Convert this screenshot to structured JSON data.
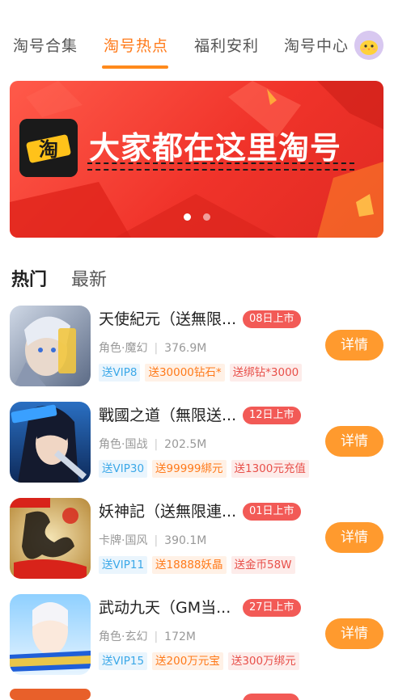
{
  "top_tabs": [
    {
      "label": "淘号合集",
      "active": false
    },
    {
      "label": "淘号热点",
      "active": true
    },
    {
      "label": "福利安利",
      "active": false
    },
    {
      "label": "淘号中心",
      "active": false
    }
  ],
  "banner": {
    "text": "大家都在这里淘号",
    "logo_glyph": "淘",
    "dots": 2,
    "active_dot": 0
  },
  "section_tabs": [
    {
      "label": "热门",
      "active": true
    },
    {
      "label": "最新",
      "active": false
    }
  ],
  "games": [
    {
      "title": "天使紀元（送無限...",
      "date": "08日上市",
      "category": "角色·魔幻",
      "size": "376.9M",
      "tags": [
        {
          "text": "送VIP8",
          "color": "blue"
        },
        {
          "text": "送30000钻石*",
          "color": "orange"
        },
        {
          "text": "送绑钻*3000",
          "color": "red"
        }
      ],
      "button": "详情",
      "icon": "angel-knight-icon"
    },
    {
      "title": "戰國之道（無限送...",
      "date": "12日上市",
      "category": "角色·国战",
      "size": "202.5M",
      "tags": [
        {
          "text": "送VIP30",
          "color": "blue"
        },
        {
          "text": "送99999綁元",
          "color": "orange"
        },
        {
          "text": "送1300元充值",
          "color": "red"
        }
      ],
      "button": "详情",
      "icon": "warrior-icon"
    },
    {
      "title": "妖神記（送無限連...",
      "date": "01日上市",
      "category": "卡牌·国风",
      "size": "390.1M",
      "tags": [
        {
          "text": "送VIP11",
          "color": "blue"
        },
        {
          "text": "送18888妖晶",
          "color": "orange"
        },
        {
          "text": "送金币58W",
          "color": "red"
        }
      ],
      "button": "详情",
      "icon": "calligraphy-icon"
    },
    {
      "title": "武动九天（GM当...",
      "date": "27日上市",
      "category": "角色·玄幻",
      "size": "172M",
      "tags": [
        {
          "text": "送VIP15",
          "color": "blue"
        },
        {
          "text": "送200万元宝",
          "color": "orange"
        },
        {
          "text": "送300万绑元",
          "color": "red"
        }
      ],
      "button": "详情",
      "icon": "gm-privilege-icon"
    }
  ],
  "colors": {
    "accent": "#ff8a1c",
    "badge": "#f25a56",
    "button": "#ff9a2e",
    "banner": "#f0332a"
  }
}
